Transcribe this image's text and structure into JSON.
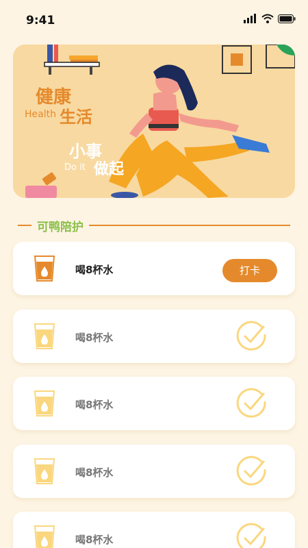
{
  "status": {
    "time": "9:41"
  },
  "banner": {
    "title_cn_1": "健康",
    "title_en_1": "Health",
    "title_cn_2": "生活",
    "title_cn_3": "小事",
    "title_en_2": "Do it",
    "title_cn_4": "做起"
  },
  "section": {
    "title": "可鸭陪护"
  },
  "tasks": [
    {
      "label": "喝8杯水",
      "action": "打卡",
      "done": false
    },
    {
      "label": "喝8杯水",
      "done": true
    },
    {
      "label": "喝8杯水",
      "done": true
    },
    {
      "label": "喝8杯水",
      "done": true
    },
    {
      "label": "喝8杯水",
      "done": true
    }
  ],
  "colors": {
    "accent": "#e58a2c",
    "section_title": "#8cc04b",
    "background": "#fdf4e3",
    "banner": "#f8d9a1",
    "done_icon": "#fad77e"
  }
}
